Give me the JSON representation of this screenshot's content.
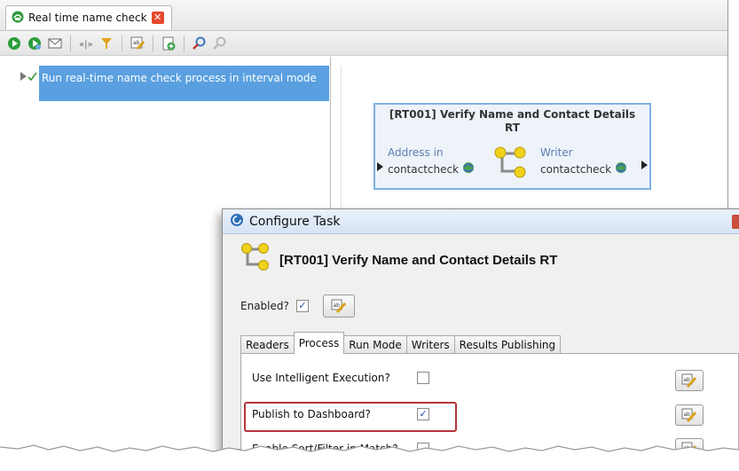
{
  "window": {
    "tab_title": "Real time name check",
    "tab_close_symbol": "✕"
  },
  "toolbar": {
    "icons": [
      "run-icon",
      "run-scheduled-icon",
      "email-icon",
      "step-through-icon",
      "filter-icon",
      "edit-notes-icon",
      "add-task-icon",
      "search-icon",
      "search-disabled-icon"
    ]
  },
  "tree": {
    "selected_item": "Run real-time name check process in interval mode"
  },
  "node": {
    "title_line1": "[RT001] Verify Name and Contact Details",
    "title_line2": "RT",
    "reader_label": "Address in",
    "reader_value": "contactcheck",
    "writer_label": "Writer",
    "writer_value": "contactcheck"
  },
  "dialog": {
    "title": "Configure Task",
    "task_name": "[RT001] Verify Name and Contact Details RT",
    "enabled_label": "Enabled?",
    "enabled_checked": true,
    "tabs": [
      {
        "label": "Readers"
      },
      {
        "label": "Process",
        "active": true
      },
      {
        "label": "Run Mode"
      },
      {
        "label": "Writers"
      },
      {
        "label": "Results Publishing"
      }
    ],
    "options": [
      {
        "label": "Use Intelligent Execution?",
        "checked": false
      },
      {
        "label": "Publish to Dashboard?",
        "checked": true
      },
      {
        "label": "Enable Sort/Filter in Match?",
        "checked": false
      }
    ],
    "check_mark": "✓"
  },
  "colors": {
    "selection": "#5aa0e0",
    "highlight_box": "#b5343b",
    "node_border": "#7fb0e6"
  }
}
